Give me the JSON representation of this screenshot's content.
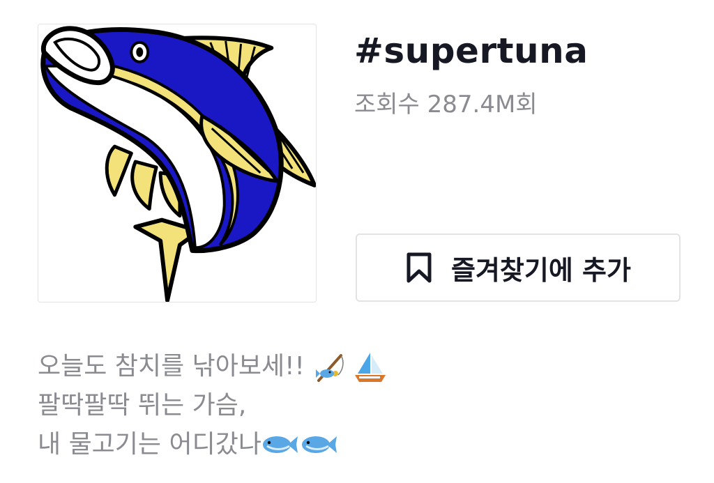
{
  "hashtag": {
    "title": "#supertuna",
    "views_text": "조회수 287.4M회",
    "cover_image": "tuna-illustration"
  },
  "favorite_button": {
    "label": "즐겨찾기에 추가",
    "icon": "bookmark-icon"
  },
  "description": {
    "lines": [
      {
        "text": "오늘도 참치를 낚아보세!!",
        "emojis": [
          "fishing-pole-emoji",
          "sailboat-emoji"
        ]
      },
      {
        "text": "팔딱팔딱 뛰는 가슴,",
        "emojis": []
      },
      {
        "text": "내 물고기는 어디갔나",
        "emojis": [
          "fish-emoji",
          "fish-emoji"
        ]
      }
    ]
  },
  "colors": {
    "text_primary": "#161823",
    "text_secondary": "#8a8b91",
    "border": "#e3e3e4",
    "tuna_blue": "#1a18c4",
    "tuna_yellow": "#f3e27a"
  }
}
